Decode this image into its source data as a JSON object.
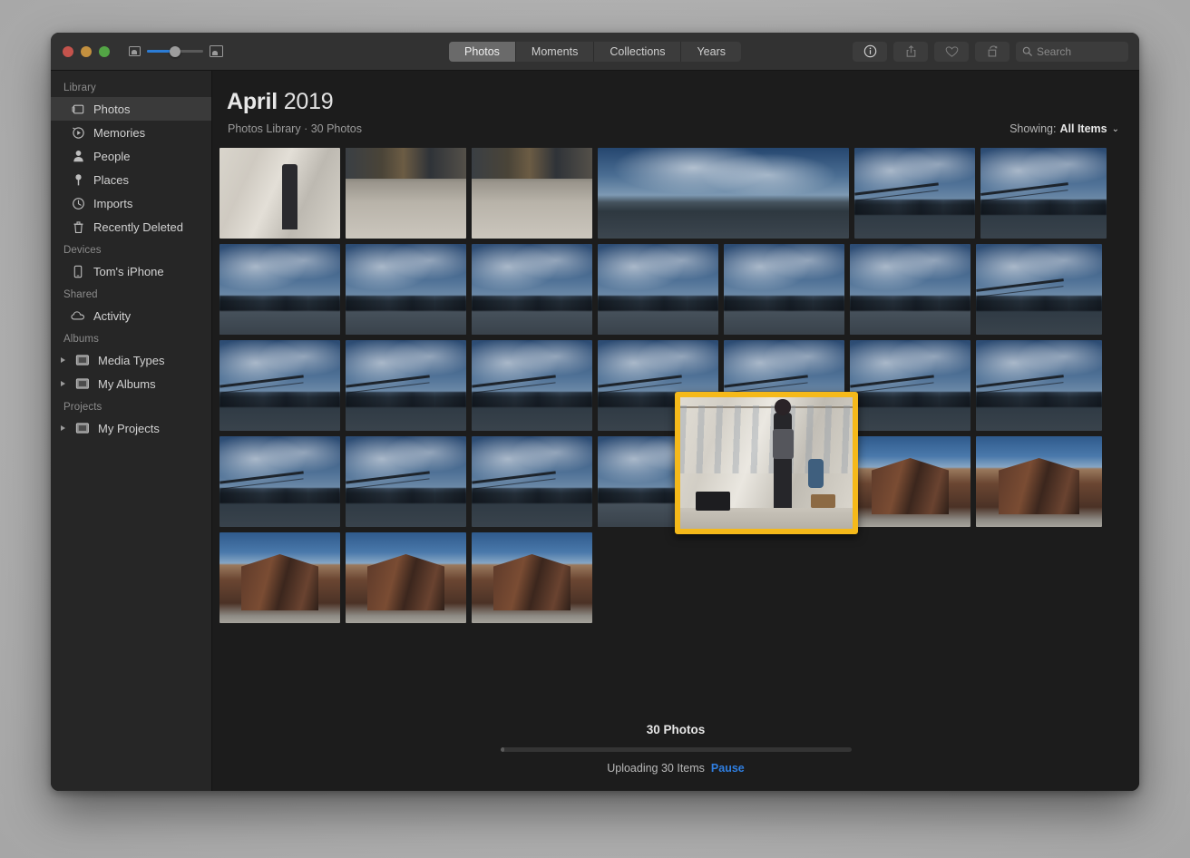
{
  "window": {
    "traffic_lights": [
      "close",
      "minimize",
      "zoom"
    ]
  },
  "toolbar": {
    "zoom_slider": {
      "small_icon": "photo-small-icon",
      "large_icon": "photo-large-icon",
      "value": 50
    },
    "tabs": [
      {
        "label": "Photos",
        "active": true
      },
      {
        "label": "Moments",
        "active": false
      },
      {
        "label": "Collections",
        "active": false
      },
      {
        "label": "Years",
        "active": false
      }
    ],
    "buttons": [
      {
        "name": "info-button",
        "icon": "info-icon",
        "enabled": true
      },
      {
        "name": "share-button",
        "icon": "share-icon",
        "enabled": false
      },
      {
        "name": "favorite-button",
        "icon": "heart-icon",
        "enabled": false
      },
      {
        "name": "rotate-button",
        "icon": "rotate-icon",
        "enabled": false
      }
    ],
    "search": {
      "placeholder": "Search",
      "value": "",
      "icon": "search-icon"
    }
  },
  "sidebar": {
    "sections": [
      {
        "header": "Library",
        "items": [
          {
            "label": "Photos",
            "icon": "photos-icon",
            "selected": true
          },
          {
            "label": "Memories",
            "icon": "memories-icon",
            "selected": false
          },
          {
            "label": "People",
            "icon": "person-icon",
            "selected": false
          },
          {
            "label": "Places",
            "icon": "pin-icon",
            "selected": false
          },
          {
            "label": "Imports",
            "icon": "clock-icon",
            "selected": false
          },
          {
            "label": "Recently Deleted",
            "icon": "trash-icon",
            "selected": false
          }
        ]
      },
      {
        "header": "Devices",
        "items": [
          {
            "label": "Tom's iPhone",
            "icon": "iphone-icon",
            "selected": false
          }
        ]
      },
      {
        "header": "Shared",
        "items": [
          {
            "label": "Activity",
            "icon": "cloud-icon",
            "selected": false
          }
        ]
      },
      {
        "header": "Albums",
        "items": [
          {
            "label": "Media Types",
            "icon": "album-icon",
            "selected": false,
            "disclosure": true
          },
          {
            "label": "My Albums",
            "icon": "album-icon",
            "selected": false,
            "disclosure": true
          }
        ]
      },
      {
        "header": "Projects",
        "items": [
          {
            "label": "My Projects",
            "icon": "album-icon",
            "selected": false,
            "disclosure": true
          }
        ]
      }
    ]
  },
  "main": {
    "title_month": "April",
    "title_year": "2019",
    "subtitle": "Photos Library · 30 Photos",
    "showing": {
      "label": "Showing:",
      "value": "All Items",
      "chevron": "⌄"
    }
  },
  "grid": {
    "rows": [
      [
        {
          "kind": "market",
          "width": "w133"
        },
        {
          "kind": "street",
          "width": "w133"
        },
        {
          "kind": "street",
          "width": "w133"
        },
        {
          "kind": "pano",
          "width": "wpan"
        },
        {
          "kind": "skyline",
          "width": "w133"
        },
        {
          "kind": "skyline",
          "width": "w139"
        }
      ],
      [
        {
          "kind": "skyline",
          "width": "w133"
        },
        {
          "kind": "skyline",
          "width": "w133"
        },
        {
          "kind": "skyline",
          "width": "w133"
        },
        {
          "kind": "skyline",
          "width": "w133"
        },
        {
          "kind": "skyline",
          "width": "w133"
        },
        {
          "kind": "skyline",
          "width": "w133"
        },
        {
          "kind": "skyline",
          "width": "w139"
        }
      ],
      [
        {
          "kind": "skyline",
          "width": "w133"
        },
        {
          "kind": "skyline",
          "width": "w133"
        },
        {
          "kind": "skyline",
          "width": "w133"
        },
        {
          "kind": "skyline",
          "width": "w133"
        },
        {
          "kind": "skyline",
          "width": "w133"
        },
        {
          "kind": "skyline",
          "width": "w133"
        },
        {
          "kind": "skyline",
          "width": "w139"
        }
      ],
      [
        {
          "kind": "skyline",
          "width": "w133"
        },
        {
          "kind": "skyline",
          "width": "w133"
        },
        {
          "kind": "skyline",
          "width": "w133"
        },
        {
          "kind": "skyline",
          "width": "w133"
        },
        {
          "kind": "skyline",
          "width": "w133"
        },
        {
          "kind": "building",
          "width": "w133"
        },
        {
          "kind": "building",
          "width": "w139"
        }
      ],
      [
        {
          "kind": "building",
          "width": "w133"
        },
        {
          "kind": "building",
          "width": "w133"
        },
        {
          "kind": "building",
          "width": "w133"
        }
      ]
    ]
  },
  "callout": {
    "highlight_color": "#f5b91a",
    "source_thumbnail_index": 0,
    "description": "market-tent-photo-zoomed"
  },
  "footer": {
    "count": "30 Photos",
    "progress_percent": 1,
    "upload_text": "Uploading 30 Items",
    "pause_label": "Pause",
    "pause_color": "#2f7ee0"
  }
}
